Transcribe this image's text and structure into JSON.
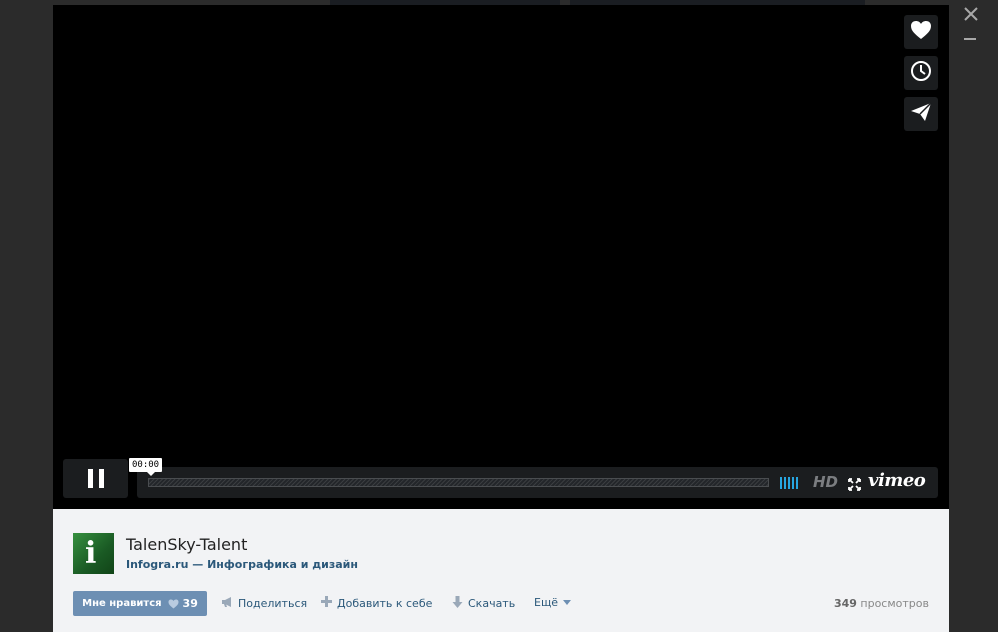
{
  "player": {
    "time": "00:00",
    "hd_label": "HD",
    "brand": "vimeo"
  },
  "video": {
    "title": "TalenSky-Talent",
    "channel": "Infogra.ru — Инфографика и дизайн"
  },
  "actions": {
    "like_label": "Мне нравится",
    "like_count": "39",
    "share": "Поделиться",
    "add": "Добавить к себе",
    "download": "Скачать",
    "more": "Ещё"
  },
  "stats": {
    "views_count": "349",
    "views_label": "просмотров"
  },
  "colors": {
    "accent": "#6d8fb3",
    "link": "#2b587a",
    "volume": "#27a6e1"
  },
  "icons": [
    "heart-icon",
    "clock-icon",
    "send-icon",
    "pause-icon",
    "fullscreen-icon",
    "close-icon",
    "minimize-icon",
    "megaphone-icon",
    "plus-icon",
    "download-icon",
    "chevron-down-icon"
  ]
}
